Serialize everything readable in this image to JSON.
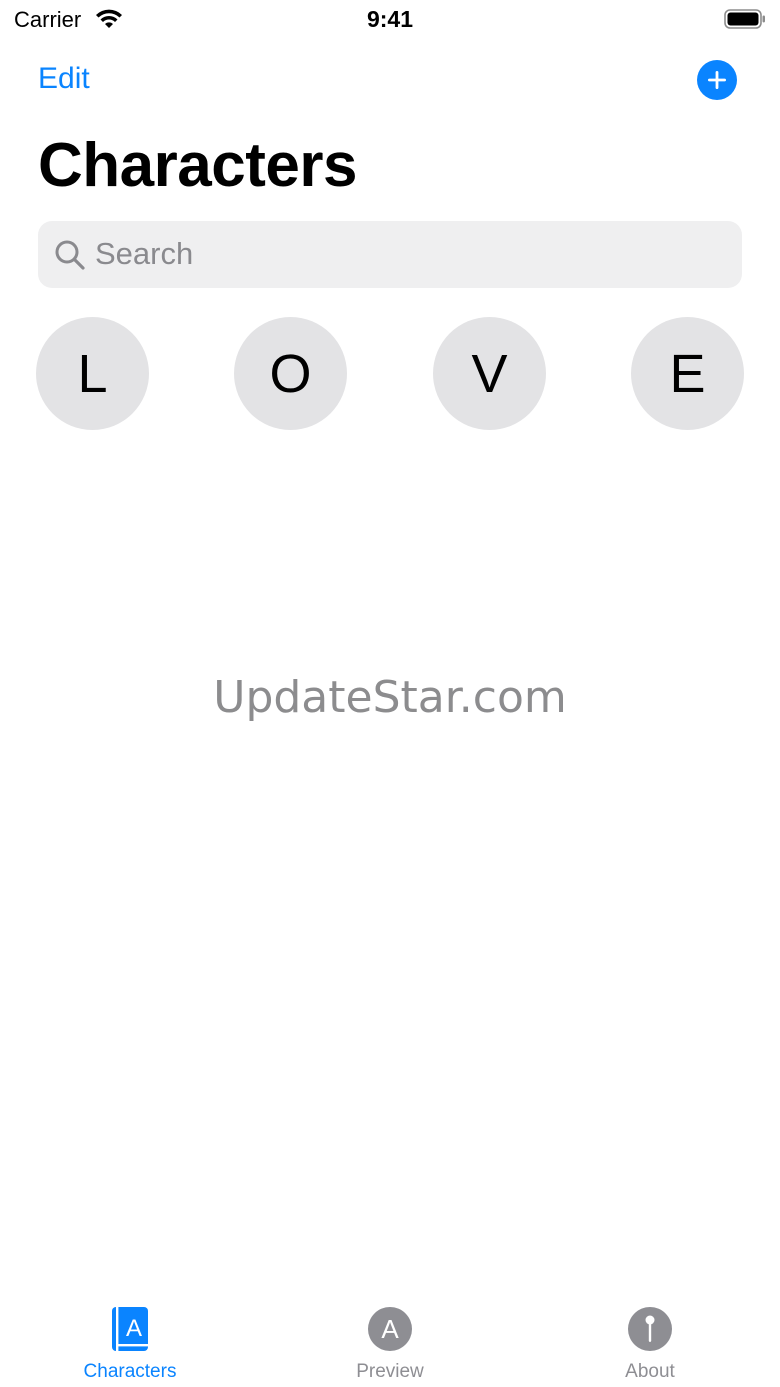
{
  "status_bar": {
    "carrier": "Carrier",
    "time": "9:41"
  },
  "nav": {
    "edit_label": "Edit",
    "add_icon": "plus-circle-icon",
    "title": "Characters"
  },
  "search": {
    "placeholder": "Search",
    "value": ""
  },
  "characters": [
    "L",
    "O",
    "V",
    "E"
  ],
  "watermark": "UpdateStar.com",
  "tabs": [
    {
      "label": "Characters",
      "icon": "book-character-icon",
      "active": true
    },
    {
      "label": "Preview",
      "icon": "character-circle-icon",
      "active": false
    },
    {
      "label": "About",
      "icon": "pin-circle-icon",
      "active": false
    }
  ],
  "colors": {
    "accent": "#0a84ff",
    "inactive": "#8e8e93",
    "bubble": "#e3e3e5",
    "search_bg": "#efeff0"
  }
}
